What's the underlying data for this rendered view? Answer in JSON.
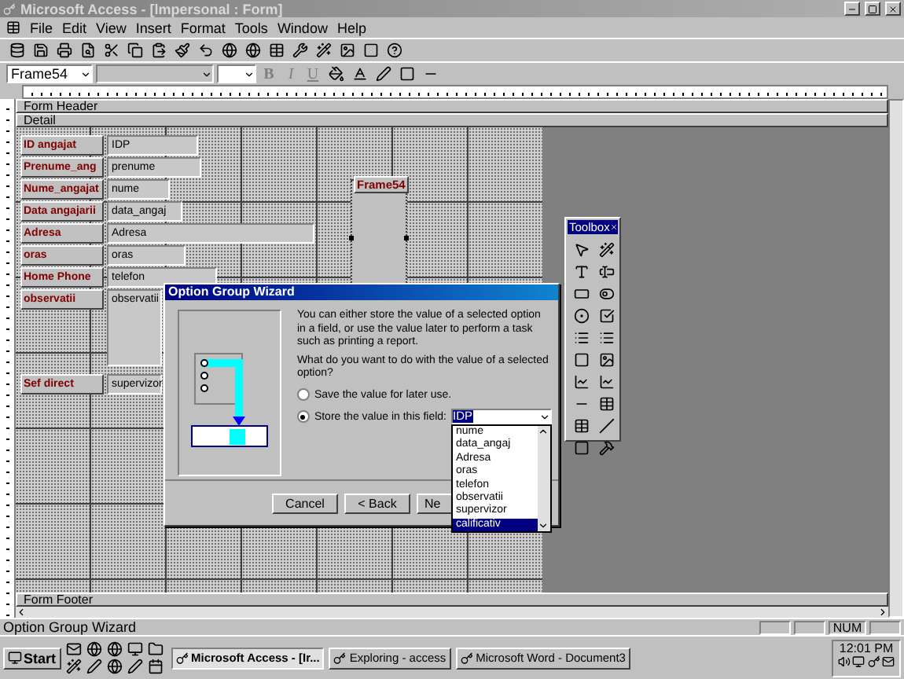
{
  "window": {
    "title": "Microsoft Access - [lmpersonal : Form]"
  },
  "menu": [
    "File",
    "Edit",
    "View",
    "Insert",
    "Format",
    "Tools",
    "Window",
    "Help"
  ],
  "format_bar": {
    "object": "Frame54",
    "style_buttons": [
      "B",
      "I",
      "U"
    ]
  },
  "form": {
    "header": "Form Header",
    "detail": "Detail",
    "footer": "Form Footer",
    "frame_label": "Frame54",
    "fields": [
      {
        "label": "ID angajat",
        "value": "IDP"
      },
      {
        "label": "Prenume_ang",
        "value": "prenume"
      },
      {
        "label": "Nume_angajat",
        "value": "nume"
      },
      {
        "label": "Data angajarii",
        "value": "data_angaj"
      },
      {
        "label": "Adresa",
        "value": "Adresa"
      },
      {
        "label": "oras",
        "value": "oras"
      },
      {
        "label": "Home Phone",
        "value": "telefon"
      },
      {
        "label": "observatii",
        "value": "observatii"
      },
      {
        "label": "Sef direct",
        "value": "supervizor"
      }
    ]
  },
  "toolbox": {
    "title": "Toolbox"
  },
  "wizard": {
    "title": "Option Group Wizard",
    "intro": "You can either store the value of a selected option in a field, or use the value later to perform a task such as printing a report.",
    "question": "What do you want to do with the value of a selected option?",
    "options": [
      {
        "label": "Save the value for later use.",
        "selected": false
      },
      {
        "label": "Store the value in this field:",
        "selected": true
      }
    ],
    "field_value": "IDP",
    "dropdown": [
      {
        "label": "nume",
        "selected": false
      },
      {
        "label": "data_angaj",
        "selected": false
      },
      {
        "label": "Adresa",
        "selected": false
      },
      {
        "label": "oras",
        "selected": false
      },
      {
        "label": "telefon",
        "selected": false
      },
      {
        "label": "observatii",
        "selected": false
      },
      {
        "label": "supervizor",
        "selected": false
      },
      {
        "label": "calificativ",
        "selected": true
      }
    ],
    "buttons": [
      "Cancel",
      "< Back",
      "Ne"
    ]
  },
  "status_bar": {
    "text": "Option Group Wizard",
    "indicator": "NUM"
  },
  "taskbar": {
    "start": "Start",
    "tasks": [
      {
        "label": "Microsoft Access - [Ir...",
        "selected": true
      },
      {
        "label": "Exploring - access",
        "selected": false
      },
      {
        "label": "Microsoft Word - Document3",
        "selected": false
      }
    ],
    "clock": "12:01 PM"
  }
}
